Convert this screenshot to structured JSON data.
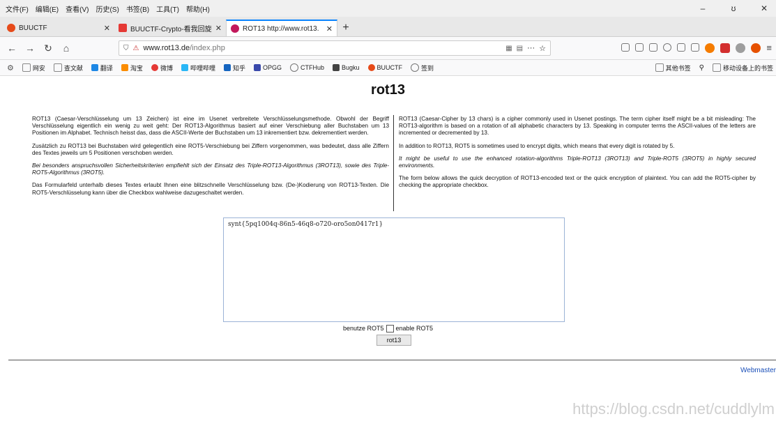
{
  "menu": [
    "文件(F)",
    "编辑(E)",
    "查看(V)",
    "历史(S)",
    "书签(B)",
    "工具(T)",
    "帮助(H)"
  ],
  "window_buttons": [
    "–",
    "ʊ",
    "✕"
  ],
  "tabs": [
    {
      "title": "BUUCTF",
      "icon_color": "#e64a19",
      "close": "✕"
    },
    {
      "title": "BUUCTF-Crypto-看我回旋踢",
      "icon_color": "#e53935",
      "close": "✕"
    },
    {
      "title": "ROT13 http://www.rot13.",
      "icon_color": "#c2185b",
      "close": "✕"
    }
  ],
  "new_tab": "+",
  "nav": {
    "back": "←",
    "forward": "→",
    "reload": "↻",
    "home": "⌂",
    "url_host": "www.rot13.de",
    "url_path": "/index.php",
    "more": "···",
    "star": "☆"
  },
  "toolbar_icons": [
    {
      "name": "download-icon",
      "color": "#555"
    },
    {
      "name": "library-icon",
      "color": "#555"
    },
    {
      "name": "sidebar-icon",
      "color": "#555"
    },
    {
      "name": "sync-icon",
      "color": "#555"
    },
    {
      "name": "screenshot-icon",
      "color": "#555"
    },
    {
      "name": "back-arrow-icon",
      "color": "#555"
    },
    {
      "name": "orange-extension-icon",
      "color": "#f57c00"
    },
    {
      "name": "red-extension-icon",
      "color": "#d32f2f"
    },
    {
      "name": "grey-extension-icon",
      "color": "#9e9e9e"
    },
    {
      "name": "firefox-icon",
      "color": "#e65100"
    },
    {
      "name": "menu-icon",
      "color": "#555"
    }
  ],
  "bookmarks": [
    {
      "label": "网安",
      "color": "#9e9e9e"
    },
    {
      "label": "查文献",
      "color": "#9e9e9e"
    },
    {
      "label": "翻译",
      "color": "#1e88e5"
    },
    {
      "label": "淘宝",
      "color": "#fb8c00"
    },
    {
      "label": "微博",
      "color": "#e53935"
    },
    {
      "label": "哔哩哔哩",
      "color": "#29b6f6"
    },
    {
      "label": "知乎",
      "color": "#1565c0"
    },
    {
      "label": "OPGG",
      "color": "#3949ab"
    },
    {
      "label": "CTFHub",
      "color": "#757575"
    },
    {
      "label": "Bugku",
      "color": "#424242"
    },
    {
      "label": "BUUCTF",
      "color": "#e64a19"
    },
    {
      "label": "签到",
      "color": "#757575"
    }
  ],
  "bookmarks_right": [
    "其他书签",
    "移动设备上的书签"
  ],
  "page": {
    "title": "rot13",
    "left_paragraphs": [
      "ROT13 (Caesar-Verschlüsselung um 13 Zeichen) ist eine im Usenet verbreitete Verschlüsselungsmethode. Obwohl der Begriff Verschlüsselung eigentlich ein wenig zu weit geht: Der ROT13-Algorithmus basiert auf einer Verschiebung aller Buchstaben um 13 Positionen im Alphabet. Technisch heisst das, dass die ASCII-Werte der Buchstaben um 13 inkrementiert bzw. dekrementiert werden.",
      "Zusätzlich zu ROT13 bei Buchstaben wird gelegentlich eine ROT5-Verschiebung bei Ziffern vorgenommen, was bedeutet, dass alle Ziffern des Textes jeweils um 5 Positionen verschoben werden.",
      "Bei besonders anspruchsvollen Sicherheitskriterien empfiehlt sich der Einsatz des Triple-ROT13-Algorithmus (3ROT13), sowie des Triple-ROT5-Algorithmus (3ROT5).",
      "Das Formularfeld unterhalb dieses Textes erlaubt Ihnen eine blitzschnelle Verschlüsselung bzw. (De-)Kodierung von ROT13-Texten. Die ROT5-Verschlüsselung kann über die Checkbox wahlweise dazugeschaltet werden."
    ],
    "right_paragraphs": [
      "ROT13 (Caesar-Cipher by 13 chars) is a cipher commonly used in Usenet postings. The term cipher itself might be a bit misleading: The ROT13-algorithm is based on a rotation of all alphabetic characters by 13. Speaking in computer terms the ASCII-values of the letters are incremented or decremented by 13.",
      "In addition to ROT13, ROT5 is sometimes used to encrypt digits, which means that every digit is rotated by 5.",
      "It might be useful to use the enhanced rotation-algorithms Triple-ROT13 (3ROT13) and Triple-ROT5 (3ROT5) in highly secured environments.",
      "The form below allows the quick decryption of ROT13-encoded text or the quick encryption of plaintext. You can add the ROT5-cipher by checking the appropriate checkbox."
    ],
    "textarea_value": "synt{5pq1004q-86n5-46q8-o720-oro5on0417r1}",
    "rot5_label_de": "benutze ROT5",
    "rot5_label_en": "enable ROT5",
    "button_label": "rot13",
    "webmaster_link": "Webmaster"
  },
  "watermark": "https://blog.csdn.net/cuddlylm"
}
